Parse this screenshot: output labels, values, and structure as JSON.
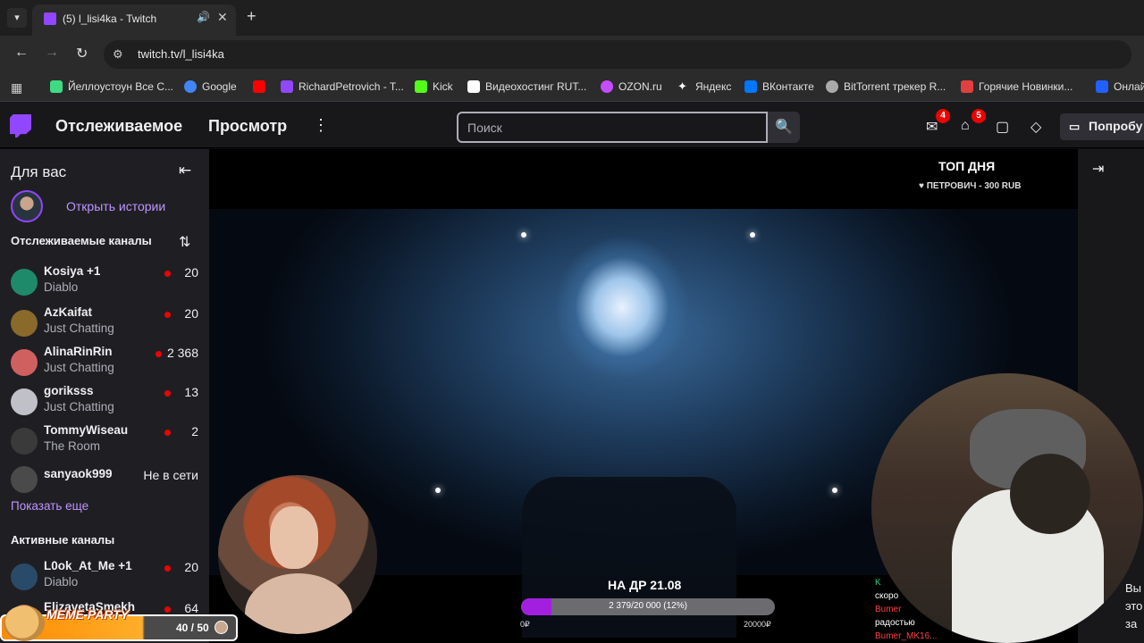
{
  "browser": {
    "tab_title": "(5) l_lisi4ka - Twitch",
    "url": "twitch.tv/l_lisi4ka",
    "bookmarks": [
      {
        "label": "Йеллоустоун Все С...",
        "icon": "film-icon",
        "color": "#3ddc84"
      },
      {
        "label": "Google",
        "icon": "google-icon",
        "color": "#4285f4"
      },
      {
        "label": "",
        "icon": "youtube-icon",
        "color": "#ff0000"
      },
      {
        "label": "RichardPetrovich - T...",
        "icon": "twitch-icon",
        "color": "#9146ff"
      },
      {
        "label": "Kick",
        "icon": "kick-icon",
        "color": "#53fc18"
      },
      {
        "label": "Видеохостинг RUT...",
        "icon": "rutube-icon",
        "color": "#ffffff"
      },
      {
        "label": "OZON.ru",
        "icon": "ozon-icon",
        "color": "#c64cff"
      },
      {
        "label": "Яндекс",
        "icon": "yandex-icon",
        "color": "#ffffff"
      },
      {
        "label": "ВКонтакте",
        "icon": "vk-icon",
        "color": "#0077ff"
      },
      {
        "label": "BitTorrent трекер R...",
        "icon": "bittorrent-icon",
        "color": "#aaaaaa"
      },
      {
        "label": "Горячие Новинки...",
        "icon": "hot-icon",
        "color": "#e04040"
      },
      {
        "label": "Онлайн",
        "icon": "online-icon",
        "color": "#2060ff"
      }
    ]
  },
  "header": {
    "nav_following": "Отслеживаемое",
    "nav_browse": "Просмотр",
    "search_placeholder": "Поиск",
    "badge_notifications": "4",
    "badge_inbox": "5",
    "try_label": "Попробу"
  },
  "sidebar": {
    "title": "Для вас",
    "stories_label": "Открыть истории",
    "followed_title": "Отслеживаемые каналы",
    "channels": [
      {
        "name": "Kosiya +1",
        "game": "Diablo",
        "viewers": "20",
        "live": true,
        "color": "#1f8a6a"
      },
      {
        "name": "AzKaifat",
        "game": "Just Chatting",
        "viewers": "20",
        "live": true,
        "color": "#8a6a2a"
      },
      {
        "name": "AlinaRinRin",
        "game": "Just Chatting",
        "viewers": "2 368",
        "live": true,
        "color": "#d06060"
      },
      {
        "name": "goriksss",
        "game": "Just Chatting",
        "viewers": "13",
        "live": true,
        "color": "#c0c0c8"
      },
      {
        "name": "TommyWiseau",
        "game": "The Room",
        "viewers": "2",
        "live": true,
        "color": "#3a3a3a"
      },
      {
        "name": "sanyaok999",
        "game": "",
        "viewers": "Не в сети",
        "live": false,
        "color": "#4a4a4a"
      }
    ],
    "show_more": "Показать еще",
    "active_title": "Активные каналы",
    "active_channels": [
      {
        "name": "L0ok_At_Me +1",
        "game": "Diablo",
        "viewers": "20",
        "live": true,
        "color": "#2a4a6a"
      },
      {
        "name": "ElizavetaSmekh",
        "game": "",
        "viewers": "64",
        "live": true,
        "color": "#a07050"
      }
    ]
  },
  "video": {
    "top_day_title": "ТОП ДНЯ",
    "top_donor": "ПЕТРОВИЧ - 300 RUB",
    "goal_title": "НА ДР 21.08",
    "goal_progress_text": "2 379/20 000 (12%)",
    "goal_fraction": 0.12,
    "goal_min": "0₽",
    "goal_max": "20000₽",
    "chat_lines": [
      "K",
      "скоро",
      "Bumer",
      "радостью",
      "Bumer_MK16..."
    ]
  },
  "right_panel": {
    "text_line1": "Вы",
    "text_line2": "это",
    "text_line3": "за"
  },
  "meme_party": {
    "title": "MEME PARTY",
    "count": "40 / 50"
  }
}
